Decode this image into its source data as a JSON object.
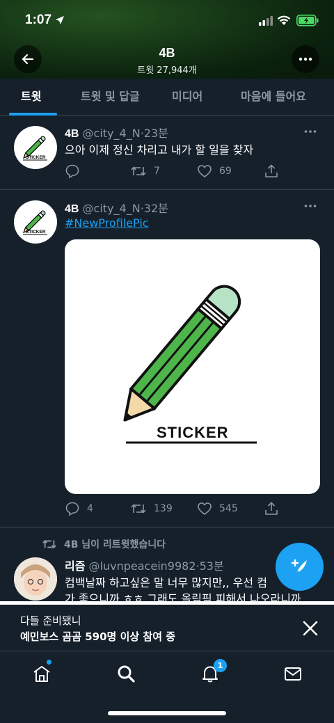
{
  "status_bar": {
    "time": "1:07"
  },
  "header": {
    "title": "4B",
    "subtitle": "트윗 27,944개"
  },
  "tabs": [
    {
      "label": "트윗",
      "active": true
    },
    {
      "label": "트윗 및 답글",
      "active": false
    },
    {
      "label": "미디어",
      "active": false
    },
    {
      "label": "마음에 들어요",
      "active": false
    }
  ],
  "tweets": [
    {
      "name": "4B",
      "handle": "@city_4_N",
      "time": "·23분",
      "text": "으아 이제 정신 차리고 내가 할 일을 찾자",
      "replies": "",
      "retweets": "7",
      "likes": "69"
    },
    {
      "name": "4B",
      "handle": "@city_4_N",
      "time": "·32분",
      "text": "#NewProfilePic",
      "media_text": "STICKER",
      "replies": "4",
      "retweets": "139",
      "likes": "545"
    },
    {
      "retweeted_by": "4B 님이 리트윗했습니다",
      "name": "리즘",
      "handle": "@luvnpeacein9982",
      "time": "·53분",
      "line1": "컴백날짜 하고싶은 말 너무 많지만,, 우선 컴",
      "line2": "가 좋으니까 ㅎㅎ 그래도 올림픽 피해서 나오라니까"
    }
  ],
  "avatar_text": "STICKER",
  "banner": {
    "line1": "다들 준비됐니",
    "line2": "예민보스 곰곰 590명 이상 참여 중"
  },
  "nav": {
    "notification_count": "1"
  },
  "colors": {
    "background": "#15202b",
    "accent": "#1da1f2",
    "green": "#4db54a",
    "muted": "#8b98a5"
  }
}
